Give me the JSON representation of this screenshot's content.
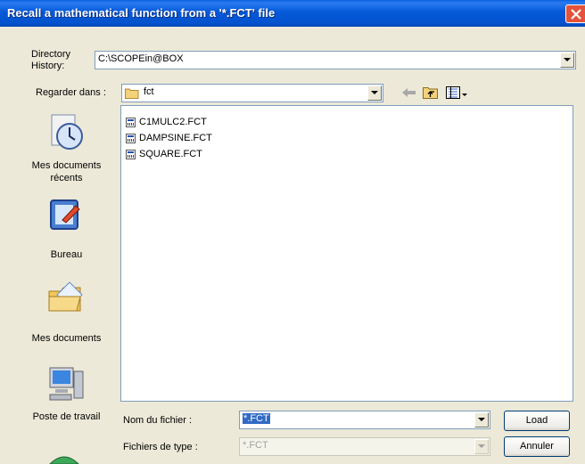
{
  "window": {
    "title": "Recall a mathematical function from a '*.FCT' file"
  },
  "directory_history": {
    "label_line1": "Directory",
    "label_line2": "History:",
    "value": "C:\\SCOPEin@BOX"
  },
  "look_in": {
    "label": "Regarder dans :",
    "value": "fct"
  },
  "places": [
    {
      "label_line1": "Mes documents",
      "label_line2": "récents",
      "icon": "recent-documents-icon"
    },
    {
      "label_line1": "Bureau",
      "label_line2": "",
      "icon": "desktop-icon"
    },
    {
      "label_line1": "Mes documents",
      "label_line2": "",
      "icon": "my-documents-icon"
    },
    {
      "label_line1": "Poste de travail",
      "label_line2": "",
      "icon": "my-computer-icon"
    }
  ],
  "files": [
    {
      "name": "C1MULC2.FCT"
    },
    {
      "name": "DAMPSINE.FCT"
    },
    {
      "name": "SQUARE.FCT"
    }
  ],
  "filename": {
    "label": "Nom du fichier :",
    "value": "*.FCT"
  },
  "filetype": {
    "label": "Fichiers de type :",
    "value": "*.FCT"
  },
  "buttons": {
    "load": "Load",
    "cancel": "Annuler"
  },
  "colors": {
    "titlebar": "#0558D8",
    "close": "#E5533A",
    "dialog_bg": "#ECE9D8",
    "selection": "#316AC5"
  }
}
